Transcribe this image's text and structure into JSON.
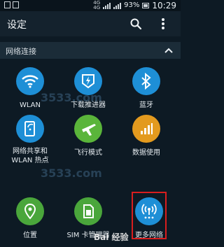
{
  "status_bar": {
    "network_top": "4G",
    "network_bottom": "4G",
    "battery": "93%",
    "time": "10:29"
  },
  "header": {
    "title": "设定",
    "search_icon": "search-icon",
    "more_icon": "more-vert-icon"
  },
  "section": {
    "title": "网络连接",
    "icon": "chevron-up-icon"
  },
  "tiles": [
    {
      "label": "WLAN",
      "icon": "wifi-icon",
      "color": "#1e8fd6"
    },
    {
      "label": "下载推进器",
      "icon": "download-booster-icon",
      "color": "#1e8fd6"
    },
    {
      "label": "蓝牙",
      "icon": "bluetooth-icon",
      "color": "#1e8fd6"
    },
    {
      "label_line1": "网络共享和",
      "label_line2": "WLAN 热点",
      "icon": "tethering-icon",
      "color": "#1e8fd6"
    },
    {
      "label": "飞行模式",
      "icon": "airplane-icon",
      "color": "#5ab53a"
    },
    {
      "label": "数据使用",
      "icon": "data-usage-icon",
      "color": "#e39a1e"
    },
    {
      "label": "位置",
      "icon": "location-icon",
      "color": "#4aa63b"
    },
    {
      "label": "SIM 卡管理器",
      "icon": "sim-card-icon",
      "color": "#4aa63b"
    },
    {
      "label": "更多网络",
      "icon": "more-networks-icon",
      "color": "#1e8fd6"
    }
  ],
  "watermarks": {
    "site": "3533.com",
    "bottom": "Bai 经验"
  }
}
